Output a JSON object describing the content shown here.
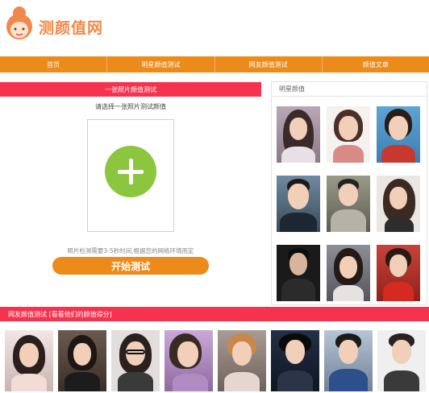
{
  "header": {
    "logo_text": "测颜值网",
    "logo_icon": "girl-face-logo-icon"
  },
  "nav": {
    "items": [
      "首页",
      "明星颜值测试",
      "网友颜值测试",
      "颜值文章"
    ]
  },
  "tester": {
    "bar_title": "一张照片颜值测试",
    "hint": "请选择一张照片测试颜值",
    "upload_icon": "plus-icon",
    "tip": "照片检测需要3-5秒时间,根据您的网络环境而定",
    "start_button": "开始测试"
  },
  "celebs": {
    "title": "明星颜值"
  },
  "users": {
    "bar_title": "网友颜值测试 [看看他们的颜值得分]"
  },
  "colors": {
    "accent_orange": "#ec8a1a",
    "accent_red": "#f5334f",
    "upload_green": "#8cc63f",
    "logo_orange": "#f08a4b"
  }
}
